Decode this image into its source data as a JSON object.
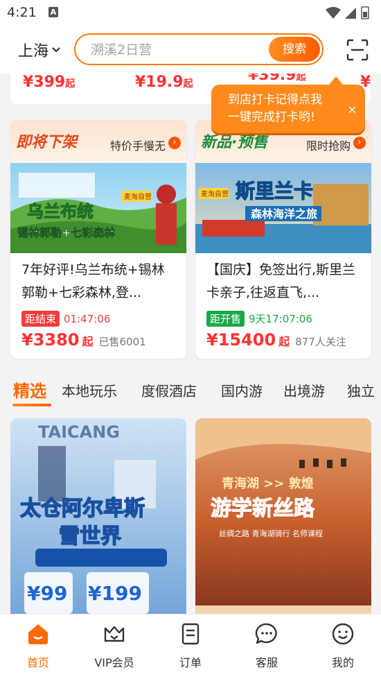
{
  "status_bar": {
    "time": "4:21",
    "notif_icon": "A"
  },
  "header": {
    "city": "上海",
    "search_placeholder": "溯溪2日营",
    "search_button": "搜索"
  },
  "top_strip": {
    "prices": [
      "¥399",
      "¥19.9",
      "¥39.9",
      "¥"
    ],
    "unit": "起"
  },
  "tooltip": {
    "line1": "到店打卡记得点我",
    "line2": "一键完成打卡哟!",
    "close": "✕"
  },
  "deals": [
    {
      "banner": "即将下架",
      "banner_sub": "特价手慢无",
      "img_text_main": "乌兰布统",
      "img_text_sub": "锡林郭勒+七彩森林",
      "img_badge": "麦淘自营",
      "title": "7年好评!乌兰布统+锡林郭勒+七彩森林,登...",
      "timer_label": "距结束",
      "timer": "01:47:06",
      "price": "¥3380",
      "unit": "起",
      "meta": "已售6001",
      "tag_color": "#f23c3c"
    },
    {
      "banner": "新品·预售",
      "banner_sub": "限时抢购",
      "img_text_main": "斯里兰卡",
      "img_text_sub": "森林海洋之旅",
      "img_badge": "麦淘自营",
      "title": "【国庆】免签出行,斯里兰卡亲子,往返直飞,...",
      "timer_label": "距开售",
      "timer": "9天17:07:06",
      "price": "¥15400",
      "unit": "起",
      "meta": "877人关注",
      "tag_color": "#1aa84a"
    }
  ],
  "tabs": [
    "精选",
    "本地玩乐",
    "度假酒店",
    "国内游",
    "出境游",
    "独立"
  ],
  "products": [
    {
      "img_text_top": "TAICANG",
      "img_text_main": "太仓阿尔卑斯",
      "img_text_sub": "雪世界",
      "price1": "¥99",
      "price2": "¥199"
    },
    {
      "img_text_top": "青海湖 >> 敦煌",
      "img_text_main": "游学新丝路",
      "img_text_sub": "丝绸之路  青海湖骑行  名师课程"
    }
  ],
  "bottom_nav": [
    {
      "label": "首页",
      "icon": "home-icon",
      "active": true
    },
    {
      "label": "VIP会员",
      "icon": "vip-crown-icon",
      "active": false
    },
    {
      "label": "订单",
      "icon": "order-icon",
      "active": false
    },
    {
      "label": "客服",
      "icon": "chat-icon",
      "active": false
    },
    {
      "label": "我的",
      "icon": "profile-icon",
      "active": false
    }
  ],
  "colors": {
    "accent": "#ff6a00",
    "price_red": "#f33333"
  }
}
